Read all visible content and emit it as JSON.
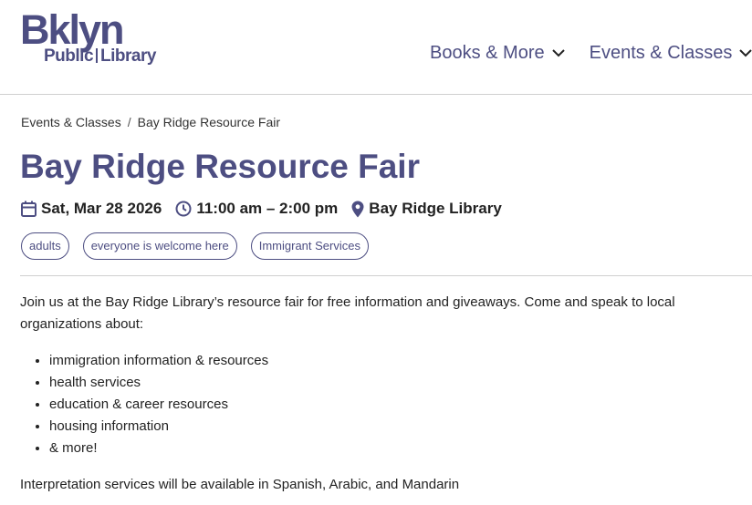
{
  "logo": {
    "main": "Bklyn",
    "sub_left": "Public",
    "sub_right": "Library"
  },
  "nav": {
    "items": [
      {
        "label": "Books & More"
      },
      {
        "label": "Events & Classes"
      }
    ]
  },
  "breadcrumb": {
    "items": [
      "Events & Classes",
      "Bay Ridge Resource Fair"
    ],
    "separator": "/"
  },
  "event": {
    "title": "Bay Ridge Resource Fair",
    "date": "Sat, Mar 28 2026",
    "time": "11:00 am – 2:00 pm",
    "location": "Bay Ridge Library",
    "tags": [
      "adults",
      "everyone is welcome here",
      "Immigrant Services"
    ]
  },
  "description": {
    "intro": "Join us at the Bay Ridge Library’s resource fair for free information and giveaways. Come and speak to local organizations about:",
    "list": [
      "immigration information & resources",
      "health services",
      "education & career resources",
      "housing information",
      "& more!"
    ],
    "outro": "Interpretation services will be available in Spanish, Arabic, and Mandarin"
  },
  "colors": {
    "brand": "#4d4e82",
    "text": "#222222",
    "divider": "#cfcfcf"
  },
  "icons": {
    "date": "calendar-icon",
    "time": "clock-icon",
    "location": "map-pin-icon",
    "dropdown": "chevron-down-icon"
  }
}
